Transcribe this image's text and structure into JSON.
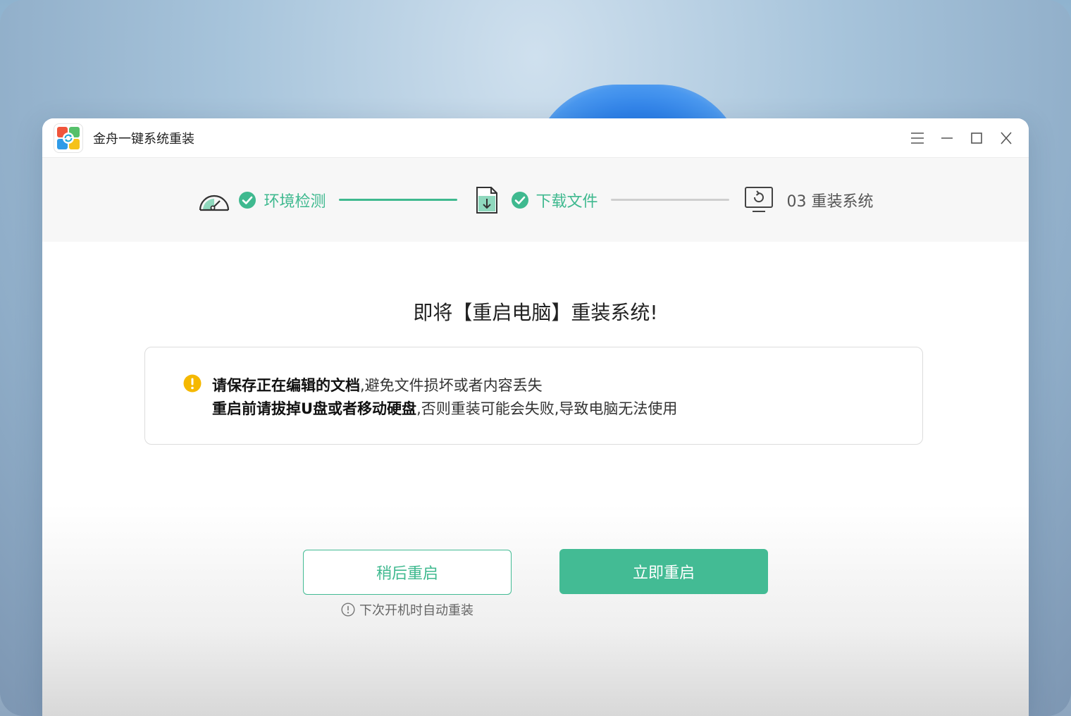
{
  "app": {
    "title": "金舟一键系统重装"
  },
  "window_controls": {
    "menu_icon": "menu-icon",
    "minimize_icon": "minimize-icon",
    "maximize_icon": "maximize-icon",
    "close_icon": "close-icon"
  },
  "steps": [
    {
      "label": "环境检测",
      "status": "done",
      "icon": "speedometer-icon"
    },
    {
      "label": "下载文件",
      "status": "done",
      "icon": "file-download-icon"
    },
    {
      "label": "03 重装系统",
      "status": "pending",
      "icon": "monitor-restart-icon"
    }
  ],
  "headline": "即将【重启电脑】重装系统!",
  "notice": {
    "line1_bold": "请保存正在编辑的文档",
    "line1_rest": ",避免文件损坏或者内容丢失",
    "line2_bold": "重启前请拔掉U盘或者移动硬盘",
    "line2_rest": ",否则重装可能会失败,导致电脑无法使用"
  },
  "buttons": {
    "later": "稍后重启",
    "now": "立即重启",
    "later_hint": "下次开机时自动重装"
  },
  "colors": {
    "accent": "#43bb94",
    "warning": "#f5b800"
  }
}
